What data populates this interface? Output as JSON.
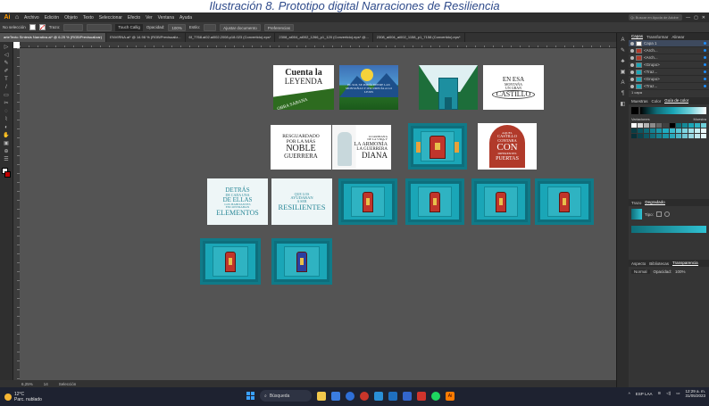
{
  "caption": "Ilustración 8. Prototipo digital Narraciones de Resiliencia",
  "menubar": {
    "logo": "Ai",
    "items": [
      "Archivo",
      "Edición",
      "Objeto",
      "Texto",
      "Seleccionar",
      "Efecto",
      "Ver",
      "Ventana",
      "Ayuda"
    ],
    "search_placeholder": "Q• Buscar en Ayuda de Adobe"
  },
  "optbar": {
    "selection": "No selección",
    "stroke_label": "Trazo:",
    "brush": "Touch Callig",
    "opacity_label": "Opacidad:",
    "opacity_value": "100%",
    "style_label": "Estilo:",
    "doc_button": "Ajustar documento",
    "prefs_button": "Preferencias"
  },
  "tabs": [
    "arteTexto Síntesis Narrativa.ai* @ 6.25 % (RGB/Previsualizar)",
    "ENVIRNA.ai* @ 14.98 % (RGB/Previsualiz...",
    "6f_7768.ai02.ai002.2008.p18.023 (Convertido).eps*",
    "2308_ai004_ai002_1266_p1_120 (Convertido).eps* @...",
    "2308_ai004_ai002_1158_p1_7158 (Convertido).eps*"
  ],
  "tools": [
    "▷",
    "◁",
    "✎",
    "✐",
    "T",
    "/",
    "▭",
    "✂",
    "◌",
    "⌇",
    "◐",
    "✋",
    "▣",
    "⊕",
    "☰"
  ],
  "status": {
    "zoom": "6,25%",
    "page": "14",
    "tool": "Selección"
  },
  "thumbs": {
    "leyenda": {
      "line1": "Cuenta la",
      "line2": "LEYENDA",
      "band": "OBRA SABANA"
    },
    "sunset": {
      "text": "EL SOL SE PONÍA ENTRE LAS MONTAÑAS Y OSCURECÍA A LO LEJOS"
    },
    "castillo": {
      "line1": "EN ESA",
      "line2": "MONTAÑA",
      "line3": "UN GRAN",
      "line4": "CASTILLO"
    },
    "resguardado": {
      "line1": "RESGUARDADO",
      "line2": "POR LA MÁS",
      "line3": "NOBLE",
      "line4": "GUERRERA"
    },
    "diana": {
      "line1": "GUARDIANA",
      "line2": "DE LA VIDA Y",
      "line3": "LA ARMONÍA",
      "line4": "LA GUERRERA",
      "line5": "DIANA"
    },
    "aquel": {
      "line1": "AQUEL",
      "line2": "CASTILLO",
      "line3": "CONTABA",
      "line4": "CON",
      "line5": "DIFERENTES",
      "line6": "PUERTAS"
    },
    "detras": {
      "line1": "DETRÁS",
      "line2": "DE CADA UNA",
      "line3": "DE ELLAS",
      "line4": "LOS HABITANTES",
      "line5": "ENCONTRABAN",
      "line6": "ELEMENTOS"
    },
    "resilientes": {
      "line1": "QUE LOS",
      "line2": "AYUDABAN",
      "line3": "A SER",
      "line4": "RESILIENTES"
    }
  },
  "rpanel": {
    "tabs": [
      "Capas",
      "Transformar",
      "Alinear"
    ],
    "layer_label": "Capa 1",
    "layers": [
      "<Arch...",
      "<Arch...",
      "<Grupo>",
      "<Traz...",
      "<Grupo>",
      "<Traz..."
    ],
    "layers_count": "1 capa",
    "color_tabs": [
      "Muestras",
      "Color",
      "Guía de color"
    ],
    "harmony_label": "Variaciones",
    "ink_label": "Muestra",
    "gradient_tabs": [
      "Trazo",
      "Degradado"
    ],
    "gradient_type": "Tipo:",
    "transp_tabs": [
      "Aspecto",
      "Bibliotecas",
      "Transparencia"
    ],
    "blend_mode": "Normal",
    "opacity_label": "Opacidad:",
    "opacity_value": "100%",
    "swatch_colors": [
      "#ffffff",
      "#d9d9d9",
      "#b3b3b3",
      "#8c8c8c",
      "#666666",
      "#404040",
      "#000000",
      "#0f6d78",
      "#148a98",
      "#1aa6b7",
      "#2fb3c2",
      "#6fd0da",
      "#0a3d44",
      "#0d5560",
      "#106b78",
      "#158192",
      "#1a97aa",
      "#20adc2",
      "#3bbcce",
      "#5bc9d8",
      "#7fd6e2",
      "#a3e3eb",
      "#c7f0f4",
      "#e9f9fb",
      "#083038",
      "#0b444e",
      "#0e5864",
      "#126d7a",
      "#168190",
      "#1b95a6",
      "#2aa7b8",
      "#4cb6c6",
      "#72c6d3",
      "#98d6e0",
      "#bee6ec",
      "#e2f5f8"
    ]
  },
  "taskbar": {
    "weather_temp": "12°C",
    "weather_desc": "Parc. nublado",
    "search": "Búsqueda",
    "lang": "ESP LAA",
    "time": "12:29 a. m.",
    "date": "31/05/2023"
  }
}
